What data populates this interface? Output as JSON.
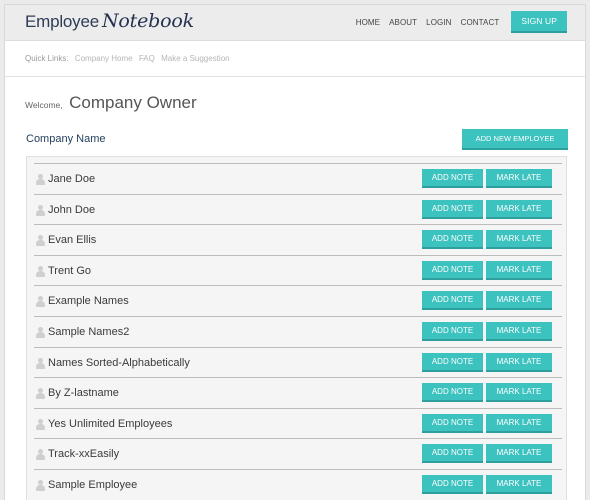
{
  "header": {
    "logo_prefix": "Employee",
    "logo_suffix": "Notebook",
    "nav": [
      "HOME",
      "ABOUT",
      "LOGIN",
      "CONTACT"
    ],
    "signup": "SIGN UP"
  },
  "quick_links": {
    "label": "Quick Links:",
    "items": [
      "Company Home",
      "FAQ",
      "Make a Suggestion"
    ]
  },
  "welcome": {
    "greeting": "Welcome,",
    "user": "Company Owner"
  },
  "company": {
    "name": "Company Name",
    "add_button": "ADD NEW EMPLOYEE"
  },
  "row_actions": {
    "note": "ADD NOTE",
    "late": "MARK LATE"
  },
  "employees": [
    "Jane Doe",
    "John Doe",
    "Evan Ellis",
    "Trent Go",
    "Example Names",
    "Sample Names2",
    "Names Sorted-Alphabetically",
    "By Z-lastname",
    "Yes Unlimited Employees",
    "Track-xxEasily",
    "Sample Employee"
  ],
  "colors": {
    "accent": "#3cc2bf",
    "brand": "#2f3c58"
  }
}
